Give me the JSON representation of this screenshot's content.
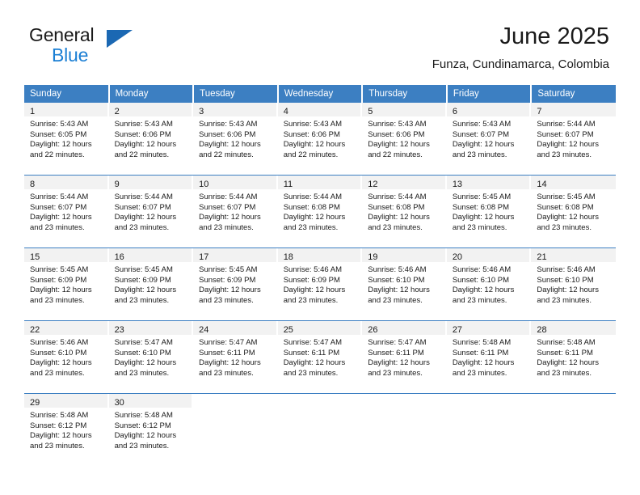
{
  "brand": {
    "line1": "General",
    "line2": "Blue",
    "triangle_color": "#1b68b3",
    "blue_text_color": "#1b7fd4"
  },
  "header": {
    "title": "June 2025",
    "subtitle": "Funza, Cundinamarca, Colombia"
  },
  "theme": {
    "header_bg": "#3c7fc2",
    "header_text": "#ffffff",
    "daynum_band_bg": "#f2f2f2",
    "row_divider": "#3c7fc2",
    "cell_bg": "#ffffff",
    "text": "#1a1a1a"
  },
  "calendar": {
    "weekday_headers": [
      "Sunday",
      "Monday",
      "Tuesday",
      "Wednesday",
      "Thursday",
      "Friday",
      "Saturday"
    ],
    "weeks": [
      [
        {
          "day": "1",
          "sunrise": "Sunrise: 5:43 AM",
          "sunset": "Sunset: 6:05 PM",
          "daylight1": "Daylight: 12 hours",
          "daylight2": "and 22 minutes."
        },
        {
          "day": "2",
          "sunrise": "Sunrise: 5:43 AM",
          "sunset": "Sunset: 6:06 PM",
          "daylight1": "Daylight: 12 hours",
          "daylight2": "and 22 minutes."
        },
        {
          "day": "3",
          "sunrise": "Sunrise: 5:43 AM",
          "sunset": "Sunset: 6:06 PM",
          "daylight1": "Daylight: 12 hours",
          "daylight2": "and 22 minutes."
        },
        {
          "day": "4",
          "sunrise": "Sunrise: 5:43 AM",
          "sunset": "Sunset: 6:06 PM",
          "daylight1": "Daylight: 12 hours",
          "daylight2": "and 22 minutes."
        },
        {
          "day": "5",
          "sunrise": "Sunrise: 5:43 AM",
          "sunset": "Sunset: 6:06 PM",
          "daylight1": "Daylight: 12 hours",
          "daylight2": "and 22 minutes."
        },
        {
          "day": "6",
          "sunrise": "Sunrise: 5:43 AM",
          "sunset": "Sunset: 6:07 PM",
          "daylight1": "Daylight: 12 hours",
          "daylight2": "and 23 minutes."
        },
        {
          "day": "7",
          "sunrise": "Sunrise: 5:44 AM",
          "sunset": "Sunset: 6:07 PM",
          "daylight1": "Daylight: 12 hours",
          "daylight2": "and 23 minutes."
        }
      ],
      [
        {
          "day": "8",
          "sunrise": "Sunrise: 5:44 AM",
          "sunset": "Sunset: 6:07 PM",
          "daylight1": "Daylight: 12 hours",
          "daylight2": "and 23 minutes."
        },
        {
          "day": "9",
          "sunrise": "Sunrise: 5:44 AM",
          "sunset": "Sunset: 6:07 PM",
          "daylight1": "Daylight: 12 hours",
          "daylight2": "and 23 minutes."
        },
        {
          "day": "10",
          "sunrise": "Sunrise: 5:44 AM",
          "sunset": "Sunset: 6:07 PM",
          "daylight1": "Daylight: 12 hours",
          "daylight2": "and 23 minutes."
        },
        {
          "day": "11",
          "sunrise": "Sunrise: 5:44 AM",
          "sunset": "Sunset: 6:08 PM",
          "daylight1": "Daylight: 12 hours",
          "daylight2": "and 23 minutes."
        },
        {
          "day": "12",
          "sunrise": "Sunrise: 5:44 AM",
          "sunset": "Sunset: 6:08 PM",
          "daylight1": "Daylight: 12 hours",
          "daylight2": "and 23 minutes."
        },
        {
          "day": "13",
          "sunrise": "Sunrise: 5:45 AM",
          "sunset": "Sunset: 6:08 PM",
          "daylight1": "Daylight: 12 hours",
          "daylight2": "and 23 minutes."
        },
        {
          "day": "14",
          "sunrise": "Sunrise: 5:45 AM",
          "sunset": "Sunset: 6:08 PM",
          "daylight1": "Daylight: 12 hours",
          "daylight2": "and 23 minutes."
        }
      ],
      [
        {
          "day": "15",
          "sunrise": "Sunrise: 5:45 AM",
          "sunset": "Sunset: 6:09 PM",
          "daylight1": "Daylight: 12 hours",
          "daylight2": "and 23 minutes."
        },
        {
          "day": "16",
          "sunrise": "Sunrise: 5:45 AM",
          "sunset": "Sunset: 6:09 PM",
          "daylight1": "Daylight: 12 hours",
          "daylight2": "and 23 minutes."
        },
        {
          "day": "17",
          "sunrise": "Sunrise: 5:45 AM",
          "sunset": "Sunset: 6:09 PM",
          "daylight1": "Daylight: 12 hours",
          "daylight2": "and 23 minutes."
        },
        {
          "day": "18",
          "sunrise": "Sunrise: 5:46 AM",
          "sunset": "Sunset: 6:09 PM",
          "daylight1": "Daylight: 12 hours",
          "daylight2": "and 23 minutes."
        },
        {
          "day": "19",
          "sunrise": "Sunrise: 5:46 AM",
          "sunset": "Sunset: 6:10 PM",
          "daylight1": "Daylight: 12 hours",
          "daylight2": "and 23 minutes."
        },
        {
          "day": "20",
          "sunrise": "Sunrise: 5:46 AM",
          "sunset": "Sunset: 6:10 PM",
          "daylight1": "Daylight: 12 hours",
          "daylight2": "and 23 minutes."
        },
        {
          "day": "21",
          "sunrise": "Sunrise: 5:46 AM",
          "sunset": "Sunset: 6:10 PM",
          "daylight1": "Daylight: 12 hours",
          "daylight2": "and 23 minutes."
        }
      ],
      [
        {
          "day": "22",
          "sunrise": "Sunrise: 5:46 AM",
          "sunset": "Sunset: 6:10 PM",
          "daylight1": "Daylight: 12 hours",
          "daylight2": "and 23 minutes."
        },
        {
          "day": "23",
          "sunrise": "Sunrise: 5:47 AM",
          "sunset": "Sunset: 6:10 PM",
          "daylight1": "Daylight: 12 hours",
          "daylight2": "and 23 minutes."
        },
        {
          "day": "24",
          "sunrise": "Sunrise: 5:47 AM",
          "sunset": "Sunset: 6:11 PM",
          "daylight1": "Daylight: 12 hours",
          "daylight2": "and 23 minutes."
        },
        {
          "day": "25",
          "sunrise": "Sunrise: 5:47 AM",
          "sunset": "Sunset: 6:11 PM",
          "daylight1": "Daylight: 12 hours",
          "daylight2": "and 23 minutes."
        },
        {
          "day": "26",
          "sunrise": "Sunrise: 5:47 AM",
          "sunset": "Sunset: 6:11 PM",
          "daylight1": "Daylight: 12 hours",
          "daylight2": "and 23 minutes."
        },
        {
          "day": "27",
          "sunrise": "Sunrise: 5:48 AM",
          "sunset": "Sunset: 6:11 PM",
          "daylight1": "Daylight: 12 hours",
          "daylight2": "and 23 minutes."
        },
        {
          "day": "28",
          "sunrise": "Sunrise: 5:48 AM",
          "sunset": "Sunset: 6:11 PM",
          "daylight1": "Daylight: 12 hours",
          "daylight2": "and 23 minutes."
        }
      ],
      [
        {
          "day": "29",
          "sunrise": "Sunrise: 5:48 AM",
          "sunset": "Sunset: 6:12 PM",
          "daylight1": "Daylight: 12 hours",
          "daylight2": "and 23 minutes."
        },
        {
          "day": "30",
          "sunrise": "Sunrise: 5:48 AM",
          "sunset": "Sunset: 6:12 PM",
          "daylight1": "Daylight: 12 hours",
          "daylight2": "and 23 minutes."
        },
        {
          "day": "",
          "sunrise": "",
          "sunset": "",
          "daylight1": "",
          "daylight2": ""
        },
        {
          "day": "",
          "sunrise": "",
          "sunset": "",
          "daylight1": "",
          "daylight2": ""
        },
        {
          "day": "",
          "sunrise": "",
          "sunset": "",
          "daylight1": "",
          "daylight2": ""
        },
        {
          "day": "",
          "sunrise": "",
          "sunset": "",
          "daylight1": "",
          "daylight2": ""
        },
        {
          "day": "",
          "sunrise": "",
          "sunset": "",
          "daylight1": "",
          "daylight2": ""
        }
      ]
    ]
  }
}
